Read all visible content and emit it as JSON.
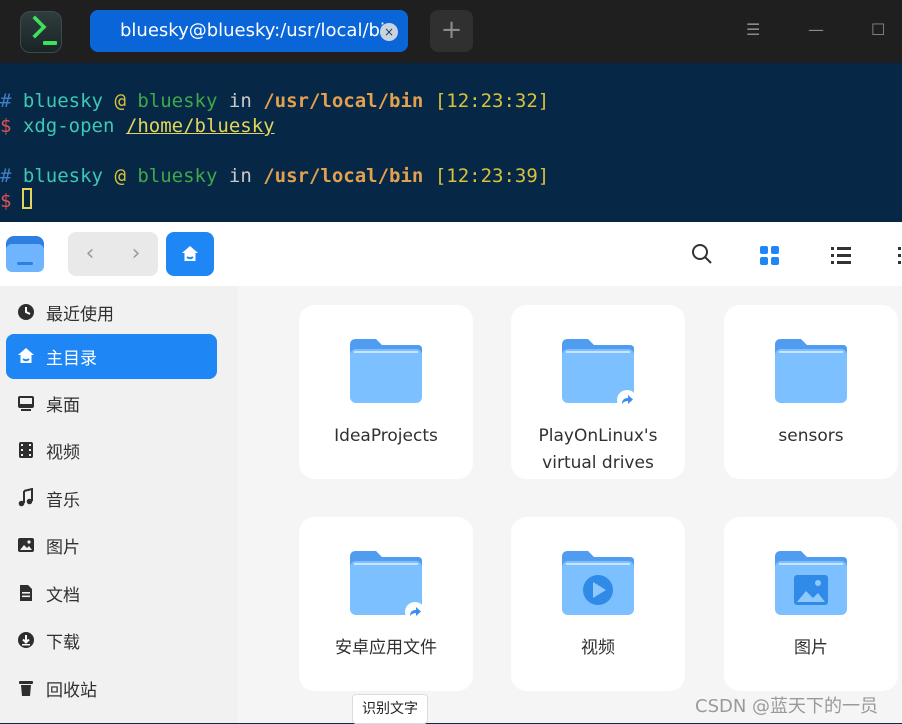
{
  "terminal": {
    "tab_title": "bluesky@bluesky:/usr/local/bin",
    "tab_close": "×",
    "new_tab": "+",
    "controls": {
      "menu": "☰",
      "minimize": "—",
      "maximize": "☐"
    },
    "lines": [
      {
        "hash": "#",
        "user": "bluesky",
        "at": "@",
        "host": "bluesky",
        "in": "in",
        "path": "/usr/local/bin",
        "time": "[12:23:32]"
      },
      {
        "dollar": "$",
        "cmd": "xdg-open",
        "arg": "/home/bluesky"
      },
      {
        "hash": "#",
        "user": "bluesky",
        "at": "@",
        "host": "bluesky",
        "in": "in",
        "path": "/usr/local/bin",
        "time": "[12:23:39]"
      },
      {
        "dollar": "$"
      }
    ]
  },
  "file_manager": {
    "nav": {
      "back": "‹",
      "forward": "›"
    },
    "sidebar": [
      {
        "label": "最近使用",
        "icon": "clock-icon"
      },
      {
        "label": "主目录",
        "icon": "home-icon",
        "active": true
      },
      {
        "label": "桌面",
        "icon": "desktop-icon"
      },
      {
        "label": "视频",
        "icon": "film-icon"
      },
      {
        "label": "音乐",
        "icon": "music-icon"
      },
      {
        "label": "图片",
        "icon": "image-icon"
      },
      {
        "label": "文档",
        "icon": "document-icon"
      },
      {
        "label": "下载",
        "icon": "download-icon"
      },
      {
        "label": "回收站",
        "icon": "trash-icon"
      }
    ],
    "folders": [
      {
        "label": "IdeaProjects",
        "type": "plain"
      },
      {
        "label": "PlayOnLinux's virtual drives",
        "type": "link"
      },
      {
        "label": "sensors",
        "type": "plain"
      },
      {
        "label": "安卓应用文件",
        "type": "link"
      },
      {
        "label": "视频",
        "type": "video"
      },
      {
        "label": "图片",
        "type": "image"
      }
    ]
  },
  "overlay": {
    "ocr_button": "识别文字"
  },
  "watermark": "CSDN @蓝天下的一员",
  "colors": {
    "accent": "#1f86f5",
    "terminal_bg": "#062846",
    "folder_light": "#7cc0ff",
    "folder_dark": "#4f9cf0"
  }
}
